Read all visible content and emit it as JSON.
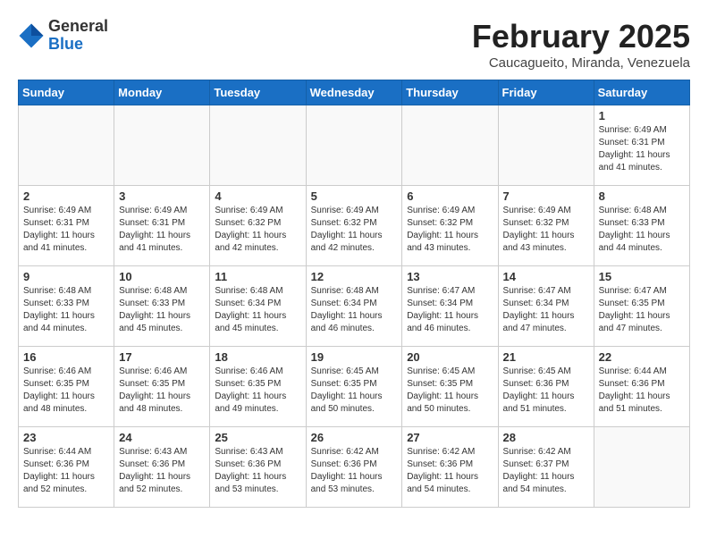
{
  "logo": {
    "general": "General",
    "blue": "Blue"
  },
  "title": "February 2025",
  "location": "Caucagueito, Miranda, Venezuela",
  "days_of_week": [
    "Sunday",
    "Monday",
    "Tuesday",
    "Wednesday",
    "Thursday",
    "Friday",
    "Saturday"
  ],
  "weeks": [
    [
      {
        "day": "",
        "info": ""
      },
      {
        "day": "",
        "info": ""
      },
      {
        "day": "",
        "info": ""
      },
      {
        "day": "",
        "info": ""
      },
      {
        "day": "",
        "info": ""
      },
      {
        "day": "",
        "info": ""
      },
      {
        "day": "1",
        "info": "Sunrise: 6:49 AM\nSunset: 6:31 PM\nDaylight: 11 hours\nand 41 minutes."
      }
    ],
    [
      {
        "day": "2",
        "info": "Sunrise: 6:49 AM\nSunset: 6:31 PM\nDaylight: 11 hours\nand 41 minutes."
      },
      {
        "day": "3",
        "info": "Sunrise: 6:49 AM\nSunset: 6:31 PM\nDaylight: 11 hours\nand 41 minutes."
      },
      {
        "day": "4",
        "info": "Sunrise: 6:49 AM\nSunset: 6:32 PM\nDaylight: 11 hours\nand 42 minutes."
      },
      {
        "day": "5",
        "info": "Sunrise: 6:49 AM\nSunset: 6:32 PM\nDaylight: 11 hours\nand 42 minutes."
      },
      {
        "day": "6",
        "info": "Sunrise: 6:49 AM\nSunset: 6:32 PM\nDaylight: 11 hours\nand 43 minutes."
      },
      {
        "day": "7",
        "info": "Sunrise: 6:49 AM\nSunset: 6:32 PM\nDaylight: 11 hours\nand 43 minutes."
      },
      {
        "day": "8",
        "info": "Sunrise: 6:48 AM\nSunset: 6:33 PM\nDaylight: 11 hours\nand 44 minutes."
      }
    ],
    [
      {
        "day": "9",
        "info": "Sunrise: 6:48 AM\nSunset: 6:33 PM\nDaylight: 11 hours\nand 44 minutes."
      },
      {
        "day": "10",
        "info": "Sunrise: 6:48 AM\nSunset: 6:33 PM\nDaylight: 11 hours\nand 45 minutes."
      },
      {
        "day": "11",
        "info": "Sunrise: 6:48 AM\nSunset: 6:34 PM\nDaylight: 11 hours\nand 45 minutes."
      },
      {
        "day": "12",
        "info": "Sunrise: 6:48 AM\nSunset: 6:34 PM\nDaylight: 11 hours\nand 46 minutes."
      },
      {
        "day": "13",
        "info": "Sunrise: 6:47 AM\nSunset: 6:34 PM\nDaylight: 11 hours\nand 46 minutes."
      },
      {
        "day": "14",
        "info": "Sunrise: 6:47 AM\nSunset: 6:34 PM\nDaylight: 11 hours\nand 47 minutes."
      },
      {
        "day": "15",
        "info": "Sunrise: 6:47 AM\nSunset: 6:35 PM\nDaylight: 11 hours\nand 47 minutes."
      }
    ],
    [
      {
        "day": "16",
        "info": "Sunrise: 6:46 AM\nSunset: 6:35 PM\nDaylight: 11 hours\nand 48 minutes."
      },
      {
        "day": "17",
        "info": "Sunrise: 6:46 AM\nSunset: 6:35 PM\nDaylight: 11 hours\nand 48 minutes."
      },
      {
        "day": "18",
        "info": "Sunrise: 6:46 AM\nSunset: 6:35 PM\nDaylight: 11 hours\nand 49 minutes."
      },
      {
        "day": "19",
        "info": "Sunrise: 6:45 AM\nSunset: 6:35 PM\nDaylight: 11 hours\nand 50 minutes."
      },
      {
        "day": "20",
        "info": "Sunrise: 6:45 AM\nSunset: 6:35 PM\nDaylight: 11 hours\nand 50 minutes."
      },
      {
        "day": "21",
        "info": "Sunrise: 6:45 AM\nSunset: 6:36 PM\nDaylight: 11 hours\nand 51 minutes."
      },
      {
        "day": "22",
        "info": "Sunrise: 6:44 AM\nSunset: 6:36 PM\nDaylight: 11 hours\nand 51 minutes."
      }
    ],
    [
      {
        "day": "23",
        "info": "Sunrise: 6:44 AM\nSunset: 6:36 PM\nDaylight: 11 hours\nand 52 minutes."
      },
      {
        "day": "24",
        "info": "Sunrise: 6:43 AM\nSunset: 6:36 PM\nDaylight: 11 hours\nand 52 minutes."
      },
      {
        "day": "25",
        "info": "Sunrise: 6:43 AM\nSunset: 6:36 PM\nDaylight: 11 hours\nand 53 minutes."
      },
      {
        "day": "26",
        "info": "Sunrise: 6:42 AM\nSunset: 6:36 PM\nDaylight: 11 hours\nand 53 minutes."
      },
      {
        "day": "27",
        "info": "Sunrise: 6:42 AM\nSunset: 6:36 PM\nDaylight: 11 hours\nand 54 minutes."
      },
      {
        "day": "28",
        "info": "Sunrise: 6:42 AM\nSunset: 6:37 PM\nDaylight: 11 hours\nand 54 minutes."
      },
      {
        "day": "",
        "info": ""
      }
    ]
  ]
}
